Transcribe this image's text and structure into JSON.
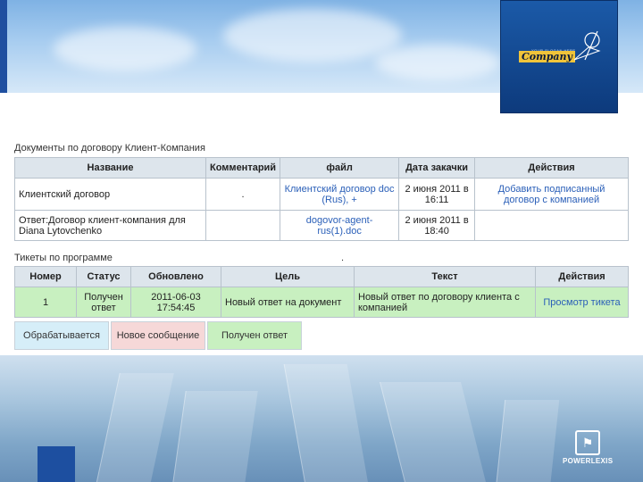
{
  "colors": {
    "accent": "#2a5fb8",
    "green_row": "#c8f0c0",
    "processing": "#d6eef8",
    "new_message": "#f6d8d8",
    "received": "#c8f0c0",
    "header_bg": "#dde5ec"
  },
  "logo": {
    "small_text": "YOUR SLOGAN HERE",
    "word": "Company"
  },
  "brand": {
    "name": "POWERLEXIS"
  },
  "documents": {
    "title": "Документы по договору Клиент-Компания",
    "headers": [
      "Название",
      "Комментарий",
      "файл",
      "Дата закачки",
      "Действия"
    ],
    "rows": [
      {
        "name": "Клиентский договор",
        "comment": ".",
        "file": "Клиентский договор doc (Rus), +",
        "date": "2 июня 2011 в 16:11",
        "action": "Добавить подписанный договор с компанией"
      },
      {
        "name": "Ответ:Договор клиент-компания для Diana Lytovchenko",
        "comment": "",
        "file": "dogovor-agent-rus(1).doc",
        "date": "2 июня 2011 в 18:40",
        "action": ""
      }
    ]
  },
  "tickets": {
    "title": "Тикеты по программе",
    "dot": ".",
    "headers": [
      "Номер",
      "Статус",
      "Обновлено",
      "Цель",
      "Текст",
      "Действия"
    ],
    "rows": [
      {
        "number": "1",
        "status": "Получен ответ",
        "updated": "2011-06-03 17:54:45",
        "goal": "Новый ответ на документ",
        "text": "Новый ответ по договору клиента с компанией",
        "action": "Просмотр тикета"
      }
    ]
  },
  "legend": [
    "Обрабатывается",
    "Новое сообщение",
    "Получен ответ"
  ]
}
